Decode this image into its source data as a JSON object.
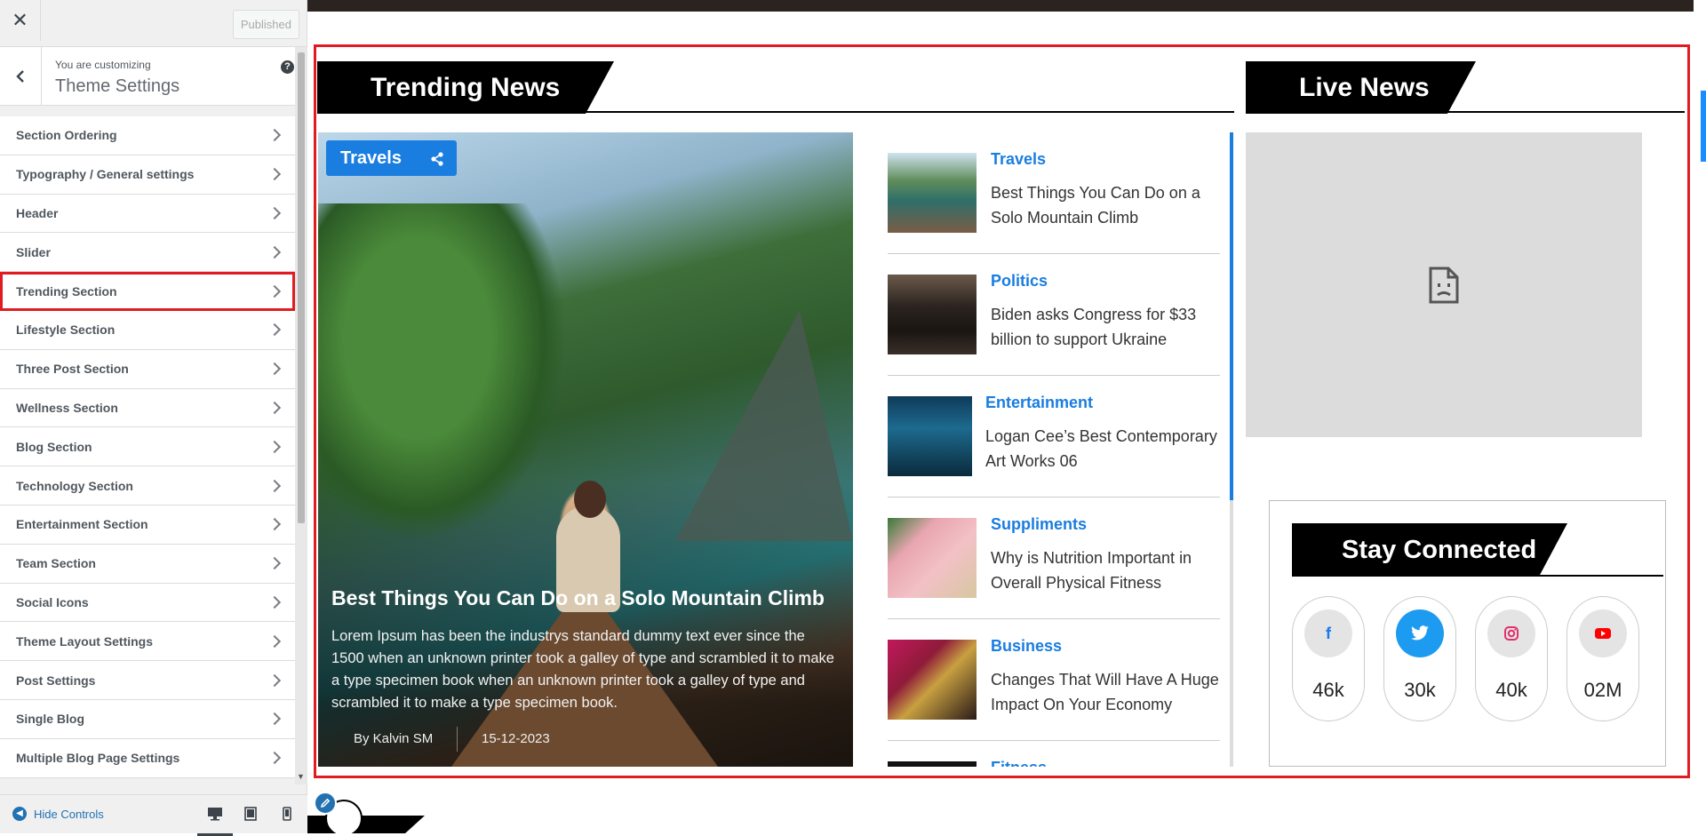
{
  "customizer": {
    "close": "✕",
    "published": "Published",
    "customizing_label": "You are customizing",
    "customizing_title": "Theme Settings",
    "help": "?",
    "sections": [
      {
        "label": "Section Ordering"
      },
      {
        "label": "Typography / General settings"
      },
      {
        "label": "Header"
      },
      {
        "label": "Slider"
      },
      {
        "label": "Trending Section"
      },
      {
        "label": "Lifestyle Section"
      },
      {
        "label": "Three Post Section"
      },
      {
        "label": "Wellness Section"
      },
      {
        "label": "Blog Section"
      },
      {
        "label": "Technology Section"
      },
      {
        "label": "Entertainment Section"
      },
      {
        "label": "Team Section"
      },
      {
        "label": "Social Icons"
      },
      {
        "label": "Theme Layout Settings"
      },
      {
        "label": "Post Settings"
      },
      {
        "label": "Single Blog"
      },
      {
        "label": "Multiple Blog Page Settings"
      }
    ],
    "hide_controls": "Hide Controls"
  },
  "trending": {
    "heading": "Trending News",
    "featured": {
      "category": "Travels",
      "title": "Best Things You Can Do on a Solo Mountain Climb",
      "description": "Lorem Ipsum has been the industrys standard dummy text ever since the 1500 when an unknown printer took a galley of type and scrambled it to make a type specimen book when an unknown printer took a galley of type and scrambled it to make a type specimen book.",
      "author": "By Kalvin SM",
      "date": "15-12-2023"
    },
    "list": [
      {
        "category": "Travels",
        "title": "Best Things You Can Do on a Solo Mountain Climb"
      },
      {
        "category": "Politics",
        "title": "Biden asks Congress for $33 billion to support Ukraine"
      },
      {
        "category": "Entertainment",
        "title": "Logan Cee’s Best Contemporary Art Works 06"
      },
      {
        "category": "Suppliments",
        "title": "Why is Nutrition Important in Overall Physical Fitness"
      },
      {
        "category": "Business",
        "title": "Changes That Will Have A Huge Impact On Your Economy"
      },
      {
        "category": "Fitness",
        "title": ""
      }
    ]
  },
  "live": {
    "heading": "Live News"
  },
  "stay_connected": {
    "heading": "Stay Connected",
    "networks": [
      {
        "icon": "facebook-icon",
        "glyph": "f",
        "count": "46k",
        "color": "#1877f2"
      },
      {
        "icon": "twitter-icon",
        "glyph": "t",
        "count": "30k",
        "color": "#1d9bf0"
      },
      {
        "icon": "instagram-icon",
        "glyph": "◎",
        "count": "40k",
        "color": "#e1306c"
      },
      {
        "icon": "youtube-icon",
        "glyph": "▶",
        "count": "02M",
        "color": "#ff0000"
      }
    ]
  }
}
